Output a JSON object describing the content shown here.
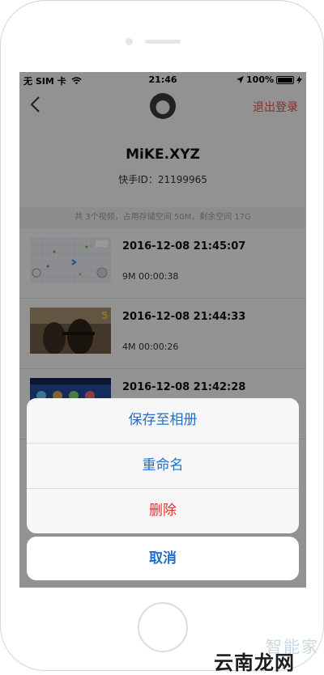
{
  "status_bar": {
    "carrier": "无 SIM 卡",
    "time": "21:46",
    "battery": "100%",
    "battery_level": 1.0
  },
  "nav": {
    "logout_label": "退出登录",
    "back_icon": "chevron-left-icon",
    "avatar_icon": "panda-avatar"
  },
  "profile": {
    "name": "MiKE.XYZ",
    "id_line": "快手ID：21199965"
  },
  "storage_info": "共 3个视频，占用存储空间 50M，剩余空间 17G",
  "videos": [
    {
      "date": "2016-12-08  21:45:07",
      "meta": "9M  00:00:38"
    },
    {
      "date": "2016-12-08  21:44:33",
      "meta": "4M  00:00:26"
    },
    {
      "date": "2016-12-08  21:42:28",
      "meta": ""
    }
  ],
  "action_sheet": {
    "options": [
      {
        "label": "保存至相册"
      },
      {
        "label": "重命名"
      },
      {
        "label": "删除"
      }
    ],
    "cancel": "取消"
  },
  "watermark": {
    "faint_text": "智能家",
    "strong_text": "云南龙网"
  },
  "colors": {
    "accent_blue": "#1f6fd1",
    "destructive_red": "#e0332f",
    "logout_red": "#d9553e"
  }
}
